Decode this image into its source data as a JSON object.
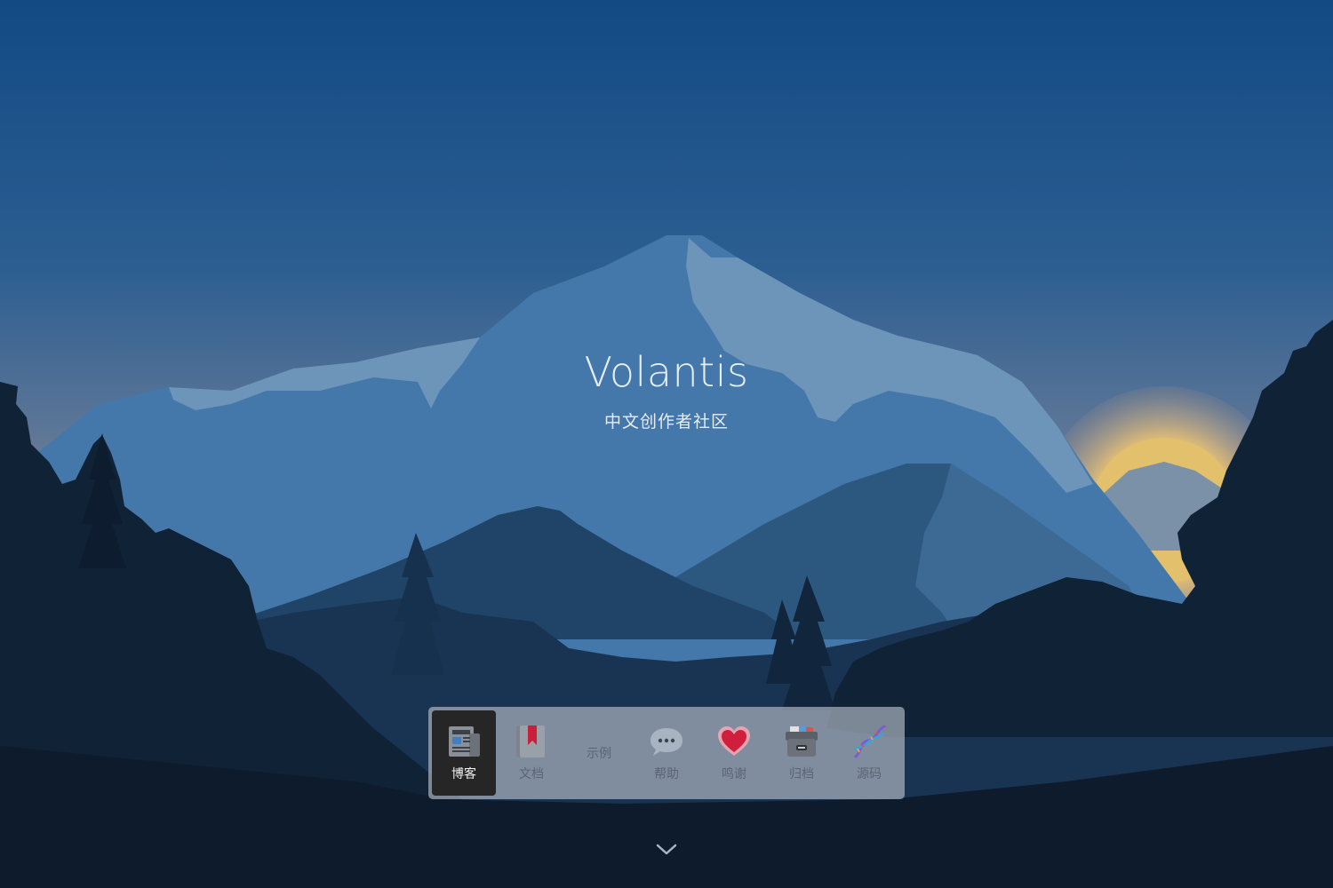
{
  "hero": {
    "title": "Volantis",
    "subtitle": "中文创作者社区"
  },
  "dock": {
    "items": [
      {
        "label": "博客",
        "icon": "newspaper-icon",
        "active": true
      },
      {
        "label": "文档",
        "icon": "bookmark-book-icon",
        "active": false
      },
      {
        "label": "示例",
        "icon": "",
        "active": false
      },
      {
        "label": "帮助",
        "icon": "speech-bubble-icon",
        "active": false
      },
      {
        "label": "鸣谢",
        "icon": "heart-icon",
        "active": false
      },
      {
        "label": "归档",
        "icon": "archive-box-icon",
        "active": false
      },
      {
        "label": "源码",
        "icon": "dna-icon",
        "active": false
      }
    ]
  },
  "scroll_indicator": {
    "icon": "chevron-down-icon"
  },
  "colors": {
    "sky_top": "#124a84",
    "sky_horizon": "#9a8a86",
    "sun": "#e7c46c",
    "mountain_light": "#4b7fae",
    "mountain_dark": "#23496e",
    "forest": "#0d1b2c",
    "dock_bg": "#a8b0bc",
    "active_bg": "#262626"
  }
}
